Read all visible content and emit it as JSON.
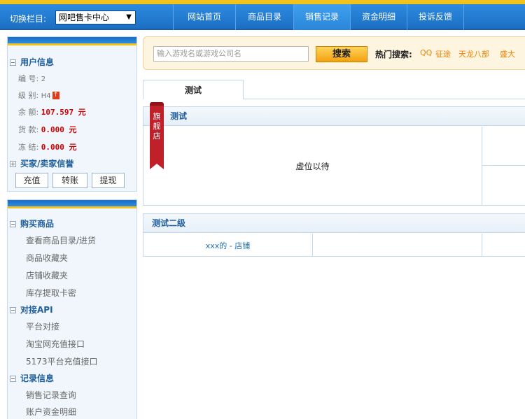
{
  "topbar": {
    "switch_label": "切换栏目:",
    "column_select": "网吧售卡中心",
    "nav": [
      "网站首页",
      "商品目录",
      "销售记录",
      "资金明细",
      "投诉反馈"
    ],
    "active_nav": "销售记录"
  },
  "user_info": {
    "title": "用户信息",
    "number_label": "编 号:",
    "number": "2",
    "level_label": "级 别:",
    "level": "H4",
    "balance_label": "余 额:",
    "balance": "107.597 元",
    "payment_label": "货 款:",
    "payment": "0.000 元",
    "frozen_label": "冻 结:",
    "frozen": "0.000 元",
    "reputation": "买家/卖家信誉",
    "buttons": [
      "充值",
      "转账",
      "提现"
    ]
  },
  "menu": {
    "sections": [
      {
        "title": "购买商品",
        "items": [
          "查看商品目录/进货",
          "商品收藏夹",
          "店铺收藏夹",
          "库存提取卡密"
        ]
      },
      {
        "title": "对接API",
        "items": [
          "平台对接",
          "淘宝网充值接口",
          "5173平台充值接口"
        ]
      },
      {
        "title": "记录信息",
        "items": [
          "销售记录查询",
          "账户资金明细"
        ]
      }
    ]
  },
  "search": {
    "placeholder": "输入游戏名或游戏公司名",
    "button": "搜索",
    "hot_label": "热门搜索:",
    "hot_terms": [
      "QQ",
      "征途",
      "天龙八部",
      "盛大"
    ]
  },
  "tabs": [
    "测试"
  ],
  "panels": [
    {
      "title": "测试",
      "ribbon": "旗舰店",
      "body": "虚位以待"
    },
    {
      "title": "测试二级",
      "link": "xxx的 - 店铺"
    }
  ],
  "colors": {
    "nav_blue": "#1b6fc3",
    "accent_yellow": "#f3c21b",
    "price_red": "#d10000",
    "ribbon_red": "#c0202a"
  }
}
